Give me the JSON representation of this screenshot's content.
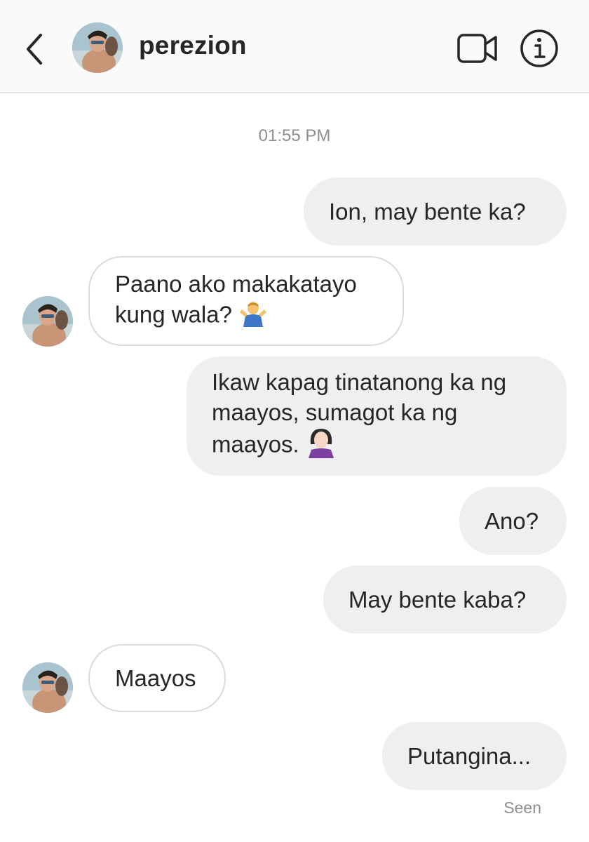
{
  "header": {
    "back_icon": "chevron-left-icon",
    "username": "perezion",
    "video_icon": "video-camera-icon",
    "info_icon": "info-icon"
  },
  "thread": {
    "timestamp": "01:55 PM",
    "messages": [
      {
        "from": "me",
        "text": "Ion, may bente ka?"
      },
      {
        "from": "them",
        "text": "Paano ako makakatayo\nkung wala?",
        "emoji": "man-shrugging"
      },
      {
        "from": "me",
        "text": "Ikaw kapag tinatanong ka ng\nmaayos, sumagot ka ng\nmaayos.",
        "emoji": "woman-facepalming"
      },
      {
        "from": "me",
        "text": "Ano?"
      },
      {
        "from": "me",
        "text": "May bente kaba?"
      },
      {
        "from": "them",
        "text": "Maayos"
      },
      {
        "from": "me",
        "text": "Putangina..."
      }
    ],
    "status": "Seen"
  },
  "colors": {
    "sent_bubble": "#efefef",
    "received_border": "#dbdbdb",
    "muted_text": "#8e8e8e",
    "text": "#262626"
  }
}
